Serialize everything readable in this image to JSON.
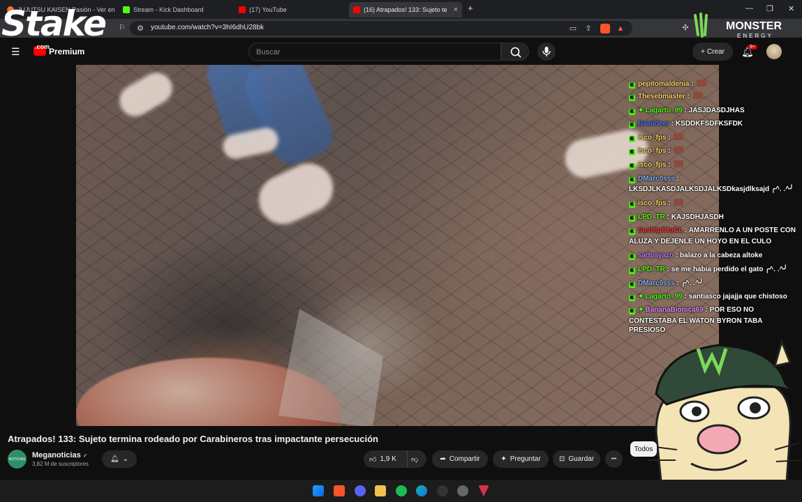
{
  "browser": {
    "tabs": [
      {
        "label": "JUJUTSU KAISEN Pasión - Ver en Crun",
        "active": false
      },
      {
        "label": "Stream - Kick Dashboard",
        "active": false
      },
      {
        "label": "(17) YouTube",
        "active": false
      },
      {
        "label": "(16) Atrapados! 133: Sujeto te",
        "active": true
      }
    ],
    "new_tab": "+",
    "url": "youtube.com/watch?v=3hI6dhU28bk"
  },
  "youtube": {
    "premium_label": "Premium",
    "search_placeholder": "Buscar",
    "create_label": "Crear",
    "notifications_badge": "9+"
  },
  "overlays": {
    "stake_text": "Stake",
    "stake_com": ".com",
    "monster_text": "MONSTER",
    "monster_sub": "ENERGY"
  },
  "chat": [
    {
      "user": "pepitomaldenia",
      "user_color": "#ffd166",
      "text": "",
      "emote": true,
      "badge": "K",
      "star": false
    },
    {
      "user": "Thesebmaster",
      "user_color": "#ffd166",
      "text": "",
      "emote": true,
      "badge": "K",
      "star": false
    },
    {
      "user": "Lagarto_99",
      "user_color": "#53fc18",
      "text": "JASJDASDJHAS",
      "emote": false,
      "badge": "K",
      "star": true
    },
    {
      "user": "Raaiideer",
      "user_color": "#4d7cff",
      "text": "KSDDKFSDFKSFDK",
      "emote": false,
      "badge": "K",
      "star": false
    },
    {
      "user": "isco_fps",
      "user_color": "#ffd166",
      "text": "",
      "emote": true,
      "badge": "K",
      "star": false
    },
    {
      "user": "isco_fps",
      "user_color": "#ffd166",
      "text": "",
      "emote": true,
      "badge": "K",
      "star": false
    },
    {
      "user": "isco_fps",
      "user_color": "#ffd166",
      "text": "",
      "emote": true,
      "badge": "K",
      "star": false
    },
    {
      "user": "DMarc0sss",
      "user_color": "#7fb2ff",
      "text": "",
      "emote": false,
      "badge": "K",
      "star": false
    },
    {
      "user": "",
      "user_color": "#ffffff",
      "text": "LKSDJLKASDJALKSDJALKSDkasjdlksajd ╭^. .^╯",
      "emote": false,
      "badge": "",
      "star": false
    },
    {
      "user": "isco_fps",
      "user_color": "#ffd166",
      "text": "",
      "emote": true,
      "badge": "K",
      "star": false
    },
    {
      "user": "LPD_TR",
      "user_color": "#53fc18",
      "text": "KAJSDHJASDH",
      "emote": false,
      "badge": "K",
      "star": false
    },
    {
      "user": "Sushipl3toCL",
      "user_color": "#ff3b3b",
      "text": "AMARRENLO A UN POSTE CON",
      "emote": false,
      "badge": "K",
      "star": false
    },
    {
      "user": "",
      "user_color": "#ffffff",
      "text": "ALUZA Y DEJENLE UN HOYO EN EL CULO",
      "emote": false,
      "badge": "",
      "star": false
    },
    {
      "user": "sadpayazo",
      "user_color": "#c17bff",
      "text": "balazo a la cabeza altoke",
      "emote": false,
      "badge": "K",
      "star": false
    },
    {
      "user": "LPD_TR",
      "user_color": "#53fc18",
      "text": "se me habia perdido el gato ╭^. .^╯",
      "emote": false,
      "badge": "K",
      "star": false
    },
    {
      "user": "DMarc0sss",
      "user_color": "#7fb2ff",
      "text": "╭^. .^╯",
      "emote": false,
      "badge": "K",
      "star": false
    },
    {
      "user": "Lagarto_99",
      "user_color": "#53fc18",
      "text": "santiasco jajajja que chistoso",
      "emote": false,
      "badge": "K",
      "star": true
    },
    {
      "user": "BananaBionica69",
      "user_color": "#e38bff",
      "text": "POR ESO NO",
      "emote": false,
      "badge": "K",
      "star": true
    },
    {
      "user": "",
      "user_color": "#ffffff",
      "text": "CONTESTABA EL WATON BYRON TABA PRESIOSO",
      "emote": false,
      "badge": "",
      "star": false
    }
  ],
  "video": {
    "title": "Atrapados! 133: Sujeto termina rodeado por Carabineros tras impactante persecución",
    "channel": "Meganoticias",
    "channel_logo_text": "NOTICIAS",
    "verified": "✓",
    "subscribers": "3,82 M de suscriptores",
    "likes": "1,9 K",
    "share_label": "Compartir",
    "ask_label": "Preguntar",
    "save_label": "Guardar",
    "more_label": "•••",
    "filter_chip": "Todos"
  },
  "colors": {
    "accent_red": "#ff0000",
    "kick_green": "#53fc18",
    "bg": "#0f0f0f"
  }
}
